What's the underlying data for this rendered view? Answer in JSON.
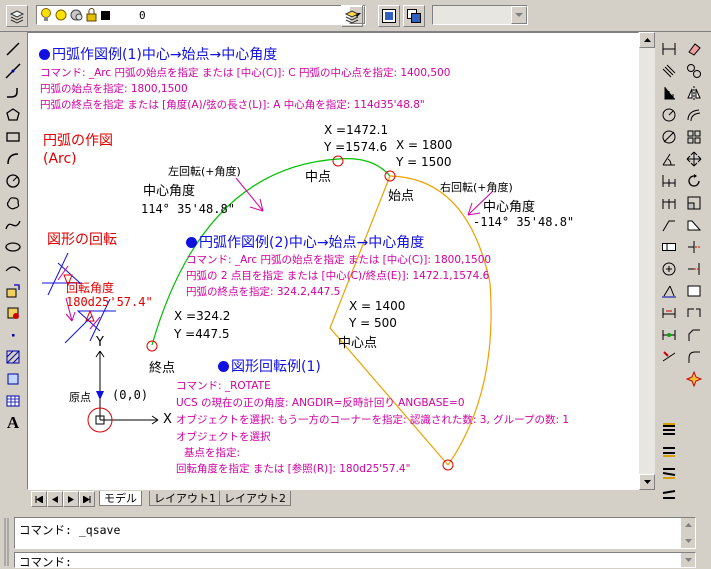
{
  "toolbar": {
    "layer_name": "0"
  },
  "tabs": [
    "モデル",
    "レイアウト1",
    "レイアウト2"
  ],
  "canvas": {
    "section1_heading": "円弧作図例(1)中心→始点→中心角度",
    "section1_lines": [
      "コマンド: _Arc 円弧の始点を指定 または [中心(C)]: C 円弧の中心点を指定: 1400,500",
      "円弧の始点を指定: 1800,1500",
      "円弧の終点を指定 または [角度(A)/弦の長さ(L)]: A 中心角を指定: 114d35'48.8\""
    ],
    "arc_title": "円弧の作図",
    "arc_title_en": "(Arc)",
    "rotate_title": "図形の回転",
    "rotate_angle_label": "回転角度",
    "rotate_angle_value": "180d25'57.4\"",
    "left_rotation": "左回転(+角度)",
    "right_rotation": "右回転(+角度)",
    "center_angle_label": "中心角度",
    "center_angle_left": "114° 35'48.8\"",
    "center_angle_right": "-114° 35'48.8\"",
    "midpoint_label": "中点",
    "midpoint_x": "X =1472.1",
    "midpoint_y": "Y =1574.6",
    "start_label": "始点",
    "start_x": "X = 1800",
    "start_y": "Y = 1500",
    "end_label": "終点",
    "end_x": "X =324.2",
    "end_y": "Y =447.5",
    "center_label": "中心点",
    "center_x": "X = 1400",
    "center_y": "Y = 500",
    "section2_heading": "円弧作図例(2)中心→始点→中心角度",
    "section2_lines": [
      "コマンド: _Arc 円弧の始点を指定 または [中心(C)]: 1800,1500",
      "円弧の 2 点目を指定 または [中心(C)/終点(E)]: 1472.1,1574.6",
      "円弧の終点を指定: 324.2,447.5"
    ],
    "section3_heading": "図形回転例(1)",
    "section3_lines": [
      "コマンド: _ROTATE",
      "UCS の現在の正の角度:  ANGDIR=反時計回り  ANGBASE=0",
      "オブジェクトを選択: もう一方のコーナーを指定: 認識された数: 3, グループの数: 1",
      "オブジェクトを選択",
      "基点を指定:",
      "回転角度を指定 または [参照(R)]: 180d25'57.4\""
    ],
    "origin_label": "原点",
    "origin_coord": "(0,0)",
    "axis_x": "X",
    "axis_y": "Y"
  },
  "command": {
    "history": "コマンド: _qsave",
    "prompt": "コマンド:"
  },
  "colors": {
    "canvas_bg": "#ffffff",
    "heading_blue": "#1010e0",
    "command_magenta": "#d000a0",
    "title_red": "#e00000",
    "arc_green": "#00c000",
    "arc_orange": "#f0a000",
    "ui_gray": "#d4d0c8"
  }
}
